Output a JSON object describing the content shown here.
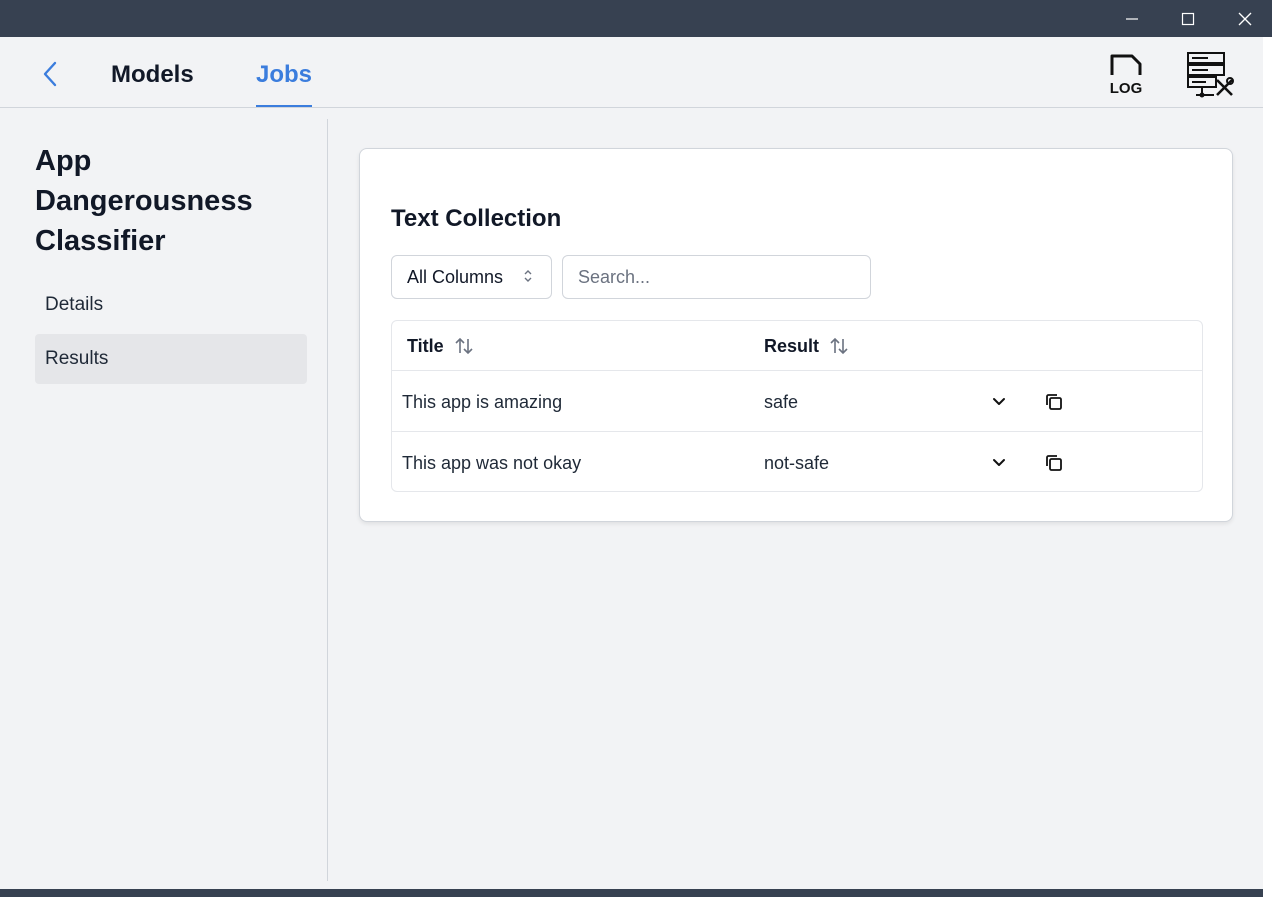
{
  "window": {
    "controls": [
      "minimize-icon",
      "maximize-icon",
      "close-icon"
    ]
  },
  "nav": {
    "back_icon": "chevron-left-icon",
    "tabs": [
      {
        "label": "Models",
        "active": false
      },
      {
        "label": "Jobs",
        "active": true
      }
    ],
    "tools": [
      {
        "icon": "log-file-icon",
        "text": "LOG"
      },
      {
        "icon": "server-settings-icon"
      }
    ],
    "accent_color": "#3b7ddd"
  },
  "sidebar": {
    "model_title": "App Dangerousness Classifier",
    "items": [
      {
        "label": "Details",
        "active": false
      },
      {
        "label": "Results",
        "active": true
      }
    ]
  },
  "main": {
    "card_title": "Text Collection",
    "column_filter": {
      "selected": "All Columns"
    },
    "search": {
      "placeholder": "Search...",
      "value": ""
    },
    "table": {
      "columns": [
        "Title",
        "Result"
      ],
      "rows": [
        {
          "title": "This app is amazing",
          "result": "safe"
        },
        {
          "title": "This app was not okay",
          "result": "not-safe"
        }
      ]
    }
  }
}
